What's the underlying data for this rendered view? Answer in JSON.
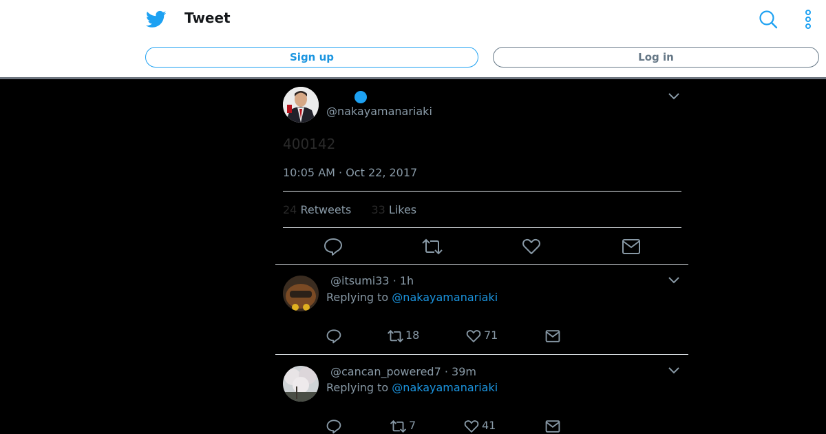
{
  "header": {
    "title": "Tweet",
    "signup_label": "Sign up",
    "login_label": "Log in",
    "colors": {
      "brand": "#1da1f2",
      "text": "#14171a",
      "muted": "#657786"
    },
    "icons": [
      "twitter-bird-icon",
      "search-icon",
      "more-vertical-icon"
    ]
  },
  "main_tweet": {
    "handle": "@nakayamanariaki",
    "body": "400142",
    "timestamp": "10:05 AM · Oct 22, 2017",
    "retweets_count": "24",
    "retweets_label": "Retweets",
    "likes_count": "33",
    "likes_label": "Likes",
    "actions": [
      "reply-icon",
      "retweet-icon",
      "like-icon",
      "message-icon"
    ]
  },
  "replies": [
    {
      "handle": "@itsumi33",
      "time": "· 1h",
      "replying_prefix": "Replying to",
      "replying_handle": "@nakayamanariaki",
      "retweets": "18",
      "likes": "71"
    },
    {
      "handle": "@cancan_powered7",
      "time": "· 39m",
      "replying_prefix": "Replying to",
      "replying_handle": "@nakayamanariaki",
      "retweets": "7",
      "likes": "41"
    }
  ]
}
